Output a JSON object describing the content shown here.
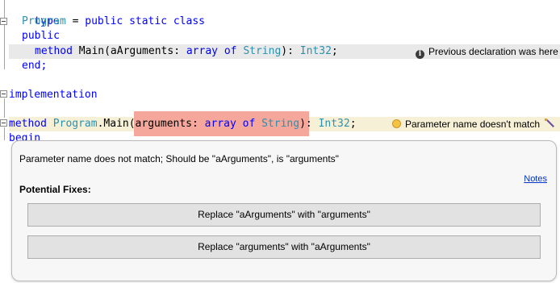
{
  "editor": {
    "line_type_kw": "type",
    "line_class_name": "Program",
    "line_class_eq": " = ",
    "line_class_mods": "public static class",
    "line_public": "public",
    "line_method_kw": "method",
    "line_method_name": " Main(aArguments: ",
    "line_method_array": "array of",
    "line_method_space": " ",
    "line_method_string": "String",
    "line_method_rest": "): ",
    "line_method_int": "Int32",
    "line_method_semi": ";",
    "line_end": "end;",
    "line_implementation": "implementation",
    "impl_method_kw": "method",
    "impl_space": " ",
    "impl_program": "Program",
    "impl_dot": ".Main",
    "impl_paren": "(arguments: ",
    "impl_array": "array of",
    "impl_space2": " ",
    "impl_string": "String",
    "impl_close": ")",
    "impl_rest": ": ",
    "impl_int": "Int32",
    "impl_semi": ";",
    "line_begin": "begin"
  },
  "annotations": {
    "previous_declaration": "Previous declaration was here",
    "error_title": "Parameter name doesn't match",
    "info_icon_glyph": "i"
  },
  "popup": {
    "message": "Parameter name does not match; Should be \"aArguments\", is \"arguments\"",
    "notes_label": "Notes",
    "fixes_heading": "Potential Fixes:",
    "fixes": [
      "Replace \"aArguments\" with \"arguments\"",
      "Replace \"arguments\" with \"aArguments\""
    ]
  },
  "colors": {
    "keyword": "#0000ff",
    "type": "#2b91af",
    "error_highlight": "#f4a79a",
    "error_row": "#f6f0d6",
    "previous_decl_row": "#e9e9e9"
  }
}
